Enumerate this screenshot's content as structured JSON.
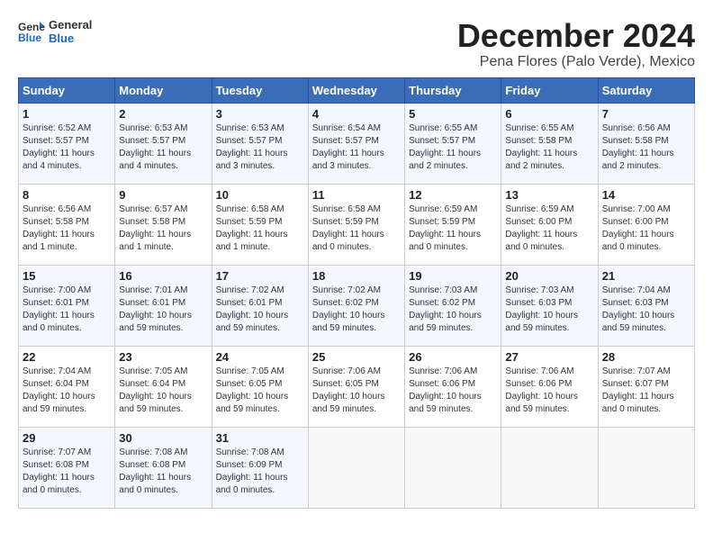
{
  "header": {
    "logo_general": "General",
    "logo_blue": "Blue",
    "month_title": "December 2024",
    "location": "Pena Flores (Palo Verde), Mexico"
  },
  "calendar": {
    "days_of_week": [
      "Sunday",
      "Monday",
      "Tuesday",
      "Wednesday",
      "Thursday",
      "Friday",
      "Saturday"
    ],
    "weeks": [
      [
        {
          "day": "",
          "info": ""
        },
        {
          "day": "2",
          "info": "Sunrise: 6:53 AM\nSunset: 5:57 PM\nDaylight: 11 hours and 4 minutes."
        },
        {
          "day": "3",
          "info": "Sunrise: 6:53 AM\nSunset: 5:57 PM\nDaylight: 11 hours and 3 minutes."
        },
        {
          "day": "4",
          "info": "Sunrise: 6:54 AM\nSunset: 5:57 PM\nDaylight: 11 hours and 3 minutes."
        },
        {
          "day": "5",
          "info": "Sunrise: 6:55 AM\nSunset: 5:57 PM\nDaylight: 11 hours and 2 minutes."
        },
        {
          "day": "6",
          "info": "Sunrise: 6:55 AM\nSunset: 5:58 PM\nDaylight: 11 hours and 2 minutes."
        },
        {
          "day": "7",
          "info": "Sunrise: 6:56 AM\nSunset: 5:58 PM\nDaylight: 11 hours and 2 minutes."
        }
      ],
      [
        {
          "day": "1",
          "info": "Sunrise: 6:52 AM\nSunset: 5:57 PM\nDaylight: 11 hours and 4 minutes."
        },
        {
          "day": "9",
          "info": "Sunrise: 6:57 AM\nSunset: 5:58 PM\nDaylight: 11 hours and 1 minute."
        },
        {
          "day": "10",
          "info": "Sunrise: 6:58 AM\nSunset: 5:59 PM\nDaylight: 11 hours and 1 minute."
        },
        {
          "day": "11",
          "info": "Sunrise: 6:58 AM\nSunset: 5:59 PM\nDaylight: 11 hours and 0 minutes."
        },
        {
          "day": "12",
          "info": "Sunrise: 6:59 AM\nSunset: 5:59 PM\nDaylight: 11 hours and 0 minutes."
        },
        {
          "day": "13",
          "info": "Sunrise: 6:59 AM\nSunset: 6:00 PM\nDaylight: 11 hours and 0 minutes."
        },
        {
          "day": "14",
          "info": "Sunrise: 7:00 AM\nSunset: 6:00 PM\nDaylight: 11 hours and 0 minutes."
        }
      ],
      [
        {
          "day": "8",
          "info": "Sunrise: 6:56 AM\nSunset: 5:58 PM\nDaylight: 11 hours and 1 minute."
        },
        {
          "day": "16",
          "info": "Sunrise: 7:01 AM\nSunset: 6:01 PM\nDaylight: 10 hours and 59 minutes."
        },
        {
          "day": "17",
          "info": "Sunrise: 7:02 AM\nSunset: 6:01 PM\nDaylight: 10 hours and 59 minutes."
        },
        {
          "day": "18",
          "info": "Sunrise: 7:02 AM\nSunset: 6:02 PM\nDaylight: 10 hours and 59 minutes."
        },
        {
          "day": "19",
          "info": "Sunrise: 7:03 AM\nSunset: 6:02 PM\nDaylight: 10 hours and 59 minutes."
        },
        {
          "day": "20",
          "info": "Sunrise: 7:03 AM\nSunset: 6:03 PM\nDaylight: 10 hours and 59 minutes."
        },
        {
          "day": "21",
          "info": "Sunrise: 7:04 AM\nSunset: 6:03 PM\nDaylight: 10 hours and 59 minutes."
        }
      ],
      [
        {
          "day": "15",
          "info": "Sunrise: 7:00 AM\nSunset: 6:01 PM\nDaylight: 11 hours and 0 minutes."
        },
        {
          "day": "23",
          "info": "Sunrise: 7:05 AM\nSunset: 6:04 PM\nDaylight: 10 hours and 59 minutes."
        },
        {
          "day": "24",
          "info": "Sunrise: 7:05 AM\nSunset: 6:05 PM\nDaylight: 10 hours and 59 minutes."
        },
        {
          "day": "25",
          "info": "Sunrise: 7:06 AM\nSunset: 6:05 PM\nDaylight: 10 hours and 59 minutes."
        },
        {
          "day": "26",
          "info": "Sunrise: 7:06 AM\nSunset: 6:06 PM\nDaylight: 10 hours and 59 minutes."
        },
        {
          "day": "27",
          "info": "Sunrise: 7:06 AM\nSunset: 6:06 PM\nDaylight: 10 hours and 59 minutes."
        },
        {
          "day": "28",
          "info": "Sunrise: 7:07 AM\nSunset: 6:07 PM\nDaylight: 11 hours and 0 minutes."
        }
      ],
      [
        {
          "day": "22",
          "info": "Sunrise: 7:04 AM\nSunset: 6:04 PM\nDaylight: 10 hours and 59 minutes."
        },
        {
          "day": "30",
          "info": "Sunrise: 7:08 AM\nSunset: 6:08 PM\nDaylight: 11 hours and 0 minutes."
        },
        {
          "day": "31",
          "info": "Sunrise: 7:08 AM\nSunset: 6:09 PM\nDaylight: 11 hours and 0 minutes."
        },
        {
          "day": "",
          "info": ""
        },
        {
          "day": "",
          "info": ""
        },
        {
          "day": "",
          "info": ""
        },
        {
          "day": "",
          "info": ""
        }
      ],
      [
        {
          "day": "29",
          "info": "Sunrise: 7:07 AM\nSunset: 6:08 PM\nDaylight: 11 hours and 0 minutes."
        },
        {
          "day": "",
          "info": ""
        },
        {
          "day": "",
          "info": ""
        },
        {
          "day": "",
          "info": ""
        },
        {
          "day": "",
          "info": ""
        },
        {
          "day": "",
          "info": ""
        },
        {
          "day": "",
          "info": ""
        }
      ]
    ]
  }
}
